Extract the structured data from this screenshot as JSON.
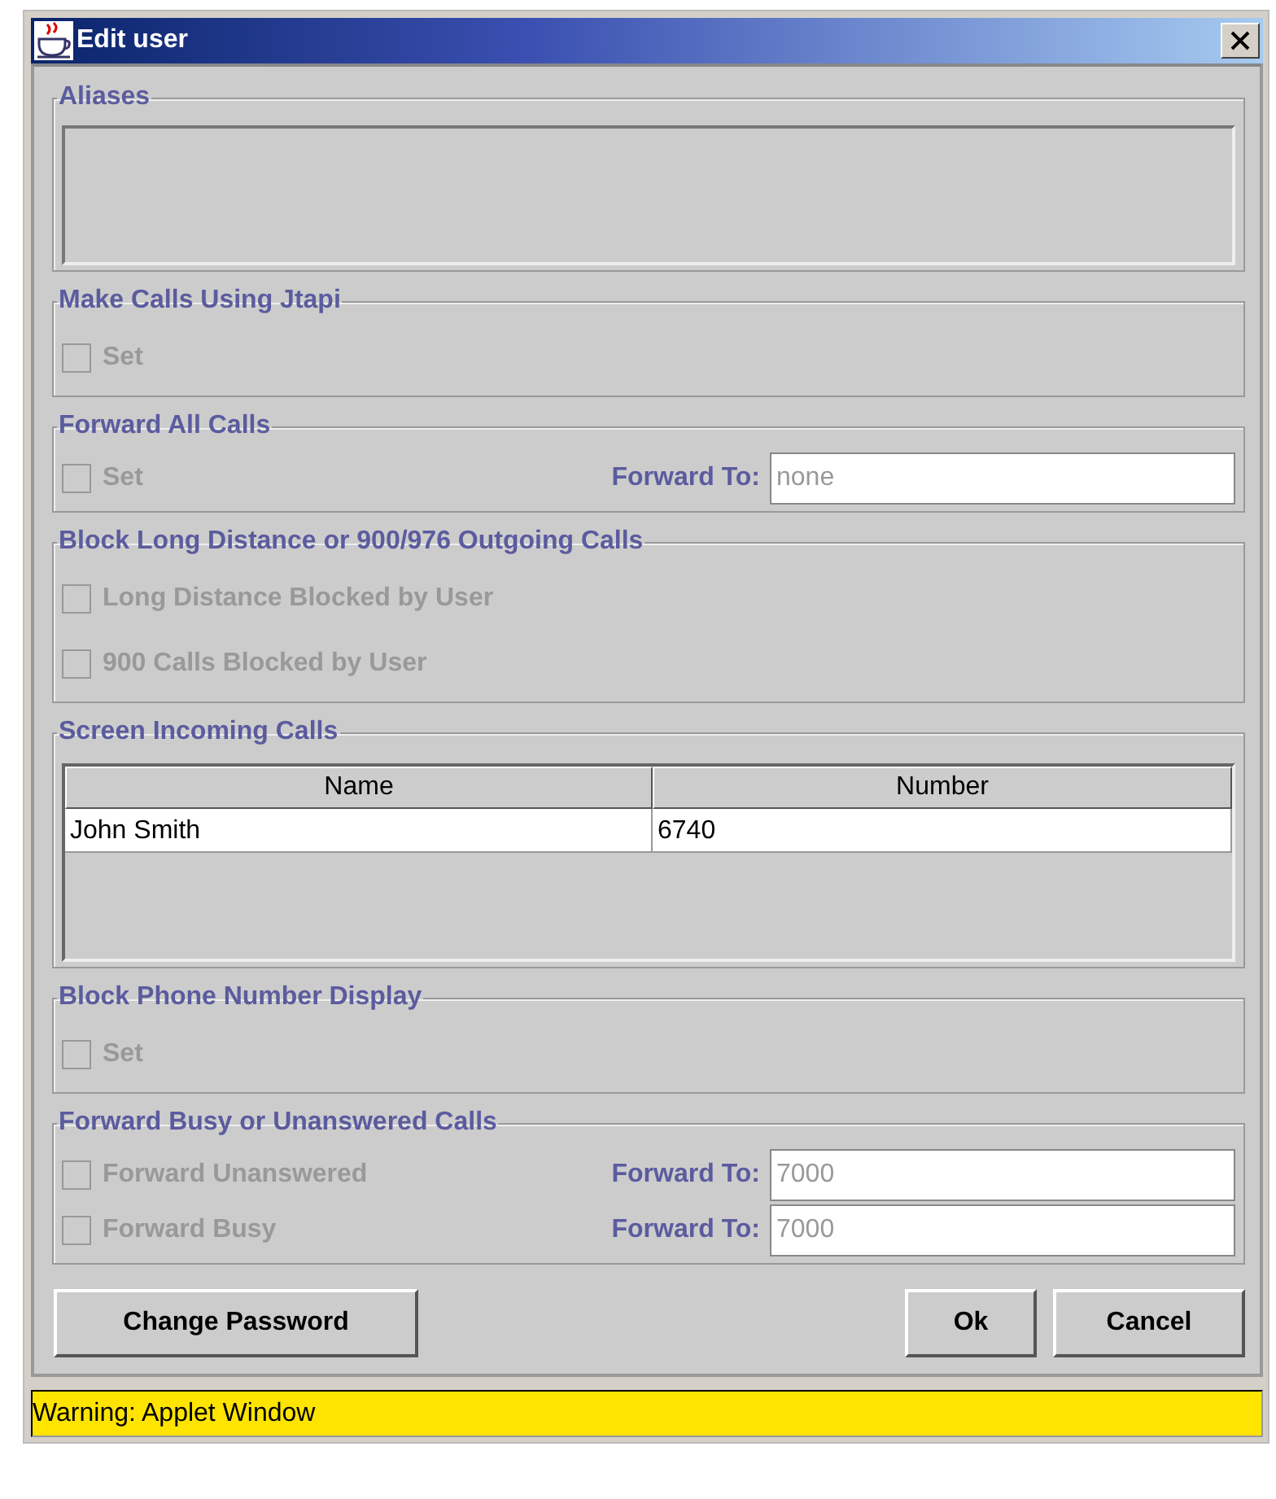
{
  "window": {
    "title": "Edit user"
  },
  "sections": [
    {
      "title": "Aliases",
      "kind": "list"
    },
    {
      "title": "Make Calls Using Jtapi",
      "kind": "options",
      "rows": [
        {
          "kind": "checkbox",
          "label": "Set",
          "checked": false,
          "disabled": true
        }
      ]
    },
    {
      "title": "Forward All Calls",
      "kind": "options",
      "rows": [
        {
          "kind": "checkbox_field",
          "label": "Set",
          "checked": false,
          "disabled": true,
          "field_label": "Forward To:",
          "value": "none"
        }
      ]
    },
    {
      "title": "Block Long Distance or 900/976 Outgoing Calls",
      "kind": "options",
      "rows": [
        {
          "kind": "checkbox",
          "label": "Long Distance Blocked by User",
          "checked": false,
          "disabled": true
        },
        {
          "kind": "checkbox",
          "label": "900 Calls Blocked by User",
          "checked": false,
          "disabled": true
        }
      ]
    },
    {
      "title": "Screen Incoming Calls",
      "kind": "table",
      "columns": [
        "Name",
        "Number"
      ],
      "rows": [
        [
          "John Smith",
          "6740"
        ]
      ]
    },
    {
      "title": "Block Phone Number Display",
      "kind": "options",
      "rows": [
        {
          "kind": "checkbox",
          "label": "Set",
          "checked": false,
          "disabled": true
        }
      ]
    },
    {
      "title": "Forward Busy or Unanswered Calls",
      "kind": "options",
      "rows": [
        {
          "kind": "checkbox_field",
          "label": "Forward Unanswered",
          "checked": false,
          "disabled": true,
          "field_label": "Forward To:",
          "value": "7000"
        },
        {
          "kind": "checkbox_field",
          "label": "Forward Busy",
          "checked": false,
          "disabled": true,
          "field_label": "Forward To:",
          "value": "7000"
        }
      ]
    }
  ],
  "buttons_left": [
    "Change Password"
  ],
  "buttons_right": [
    "Ok",
    "Cancel"
  ],
  "status_bar": "Warning: Applet Window"
}
